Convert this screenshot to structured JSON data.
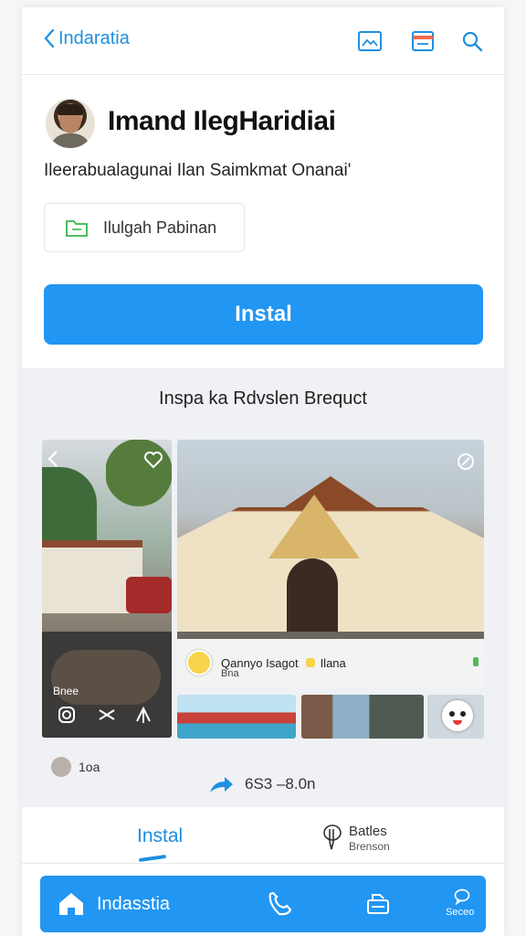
{
  "header": {
    "back_label": "Indaratia",
    "icons": [
      "image-icon",
      "calendar-icon",
      "search-icon"
    ]
  },
  "profile": {
    "name": "Imand IlegHaridiai",
    "subtitle": "Ileerabualagunai Ilan  Saimkmat Onanai'",
    "chip_label": "Ilulgah Pabinan"
  },
  "install_button": "Instal",
  "gallery": {
    "title": "Inspa ka Rdvslen Brequct",
    "caption_title": "Qannyo Isagot",
    "caption_badge": "Ilana",
    "caption_sub": "Bna",
    "left_tile_label": "Bnee"
  },
  "meta": {
    "count": "1oa",
    "share_text": "6S3 –8.0n"
  },
  "tabs": {
    "install": "Instal",
    "other_title": "Batles",
    "other_sub": "Brenson"
  },
  "navbar": {
    "home_label": "Indasstia",
    "last_label": "Seceo"
  },
  "colors": {
    "accent": "#2196f3",
    "link": "#1e8fe0"
  }
}
